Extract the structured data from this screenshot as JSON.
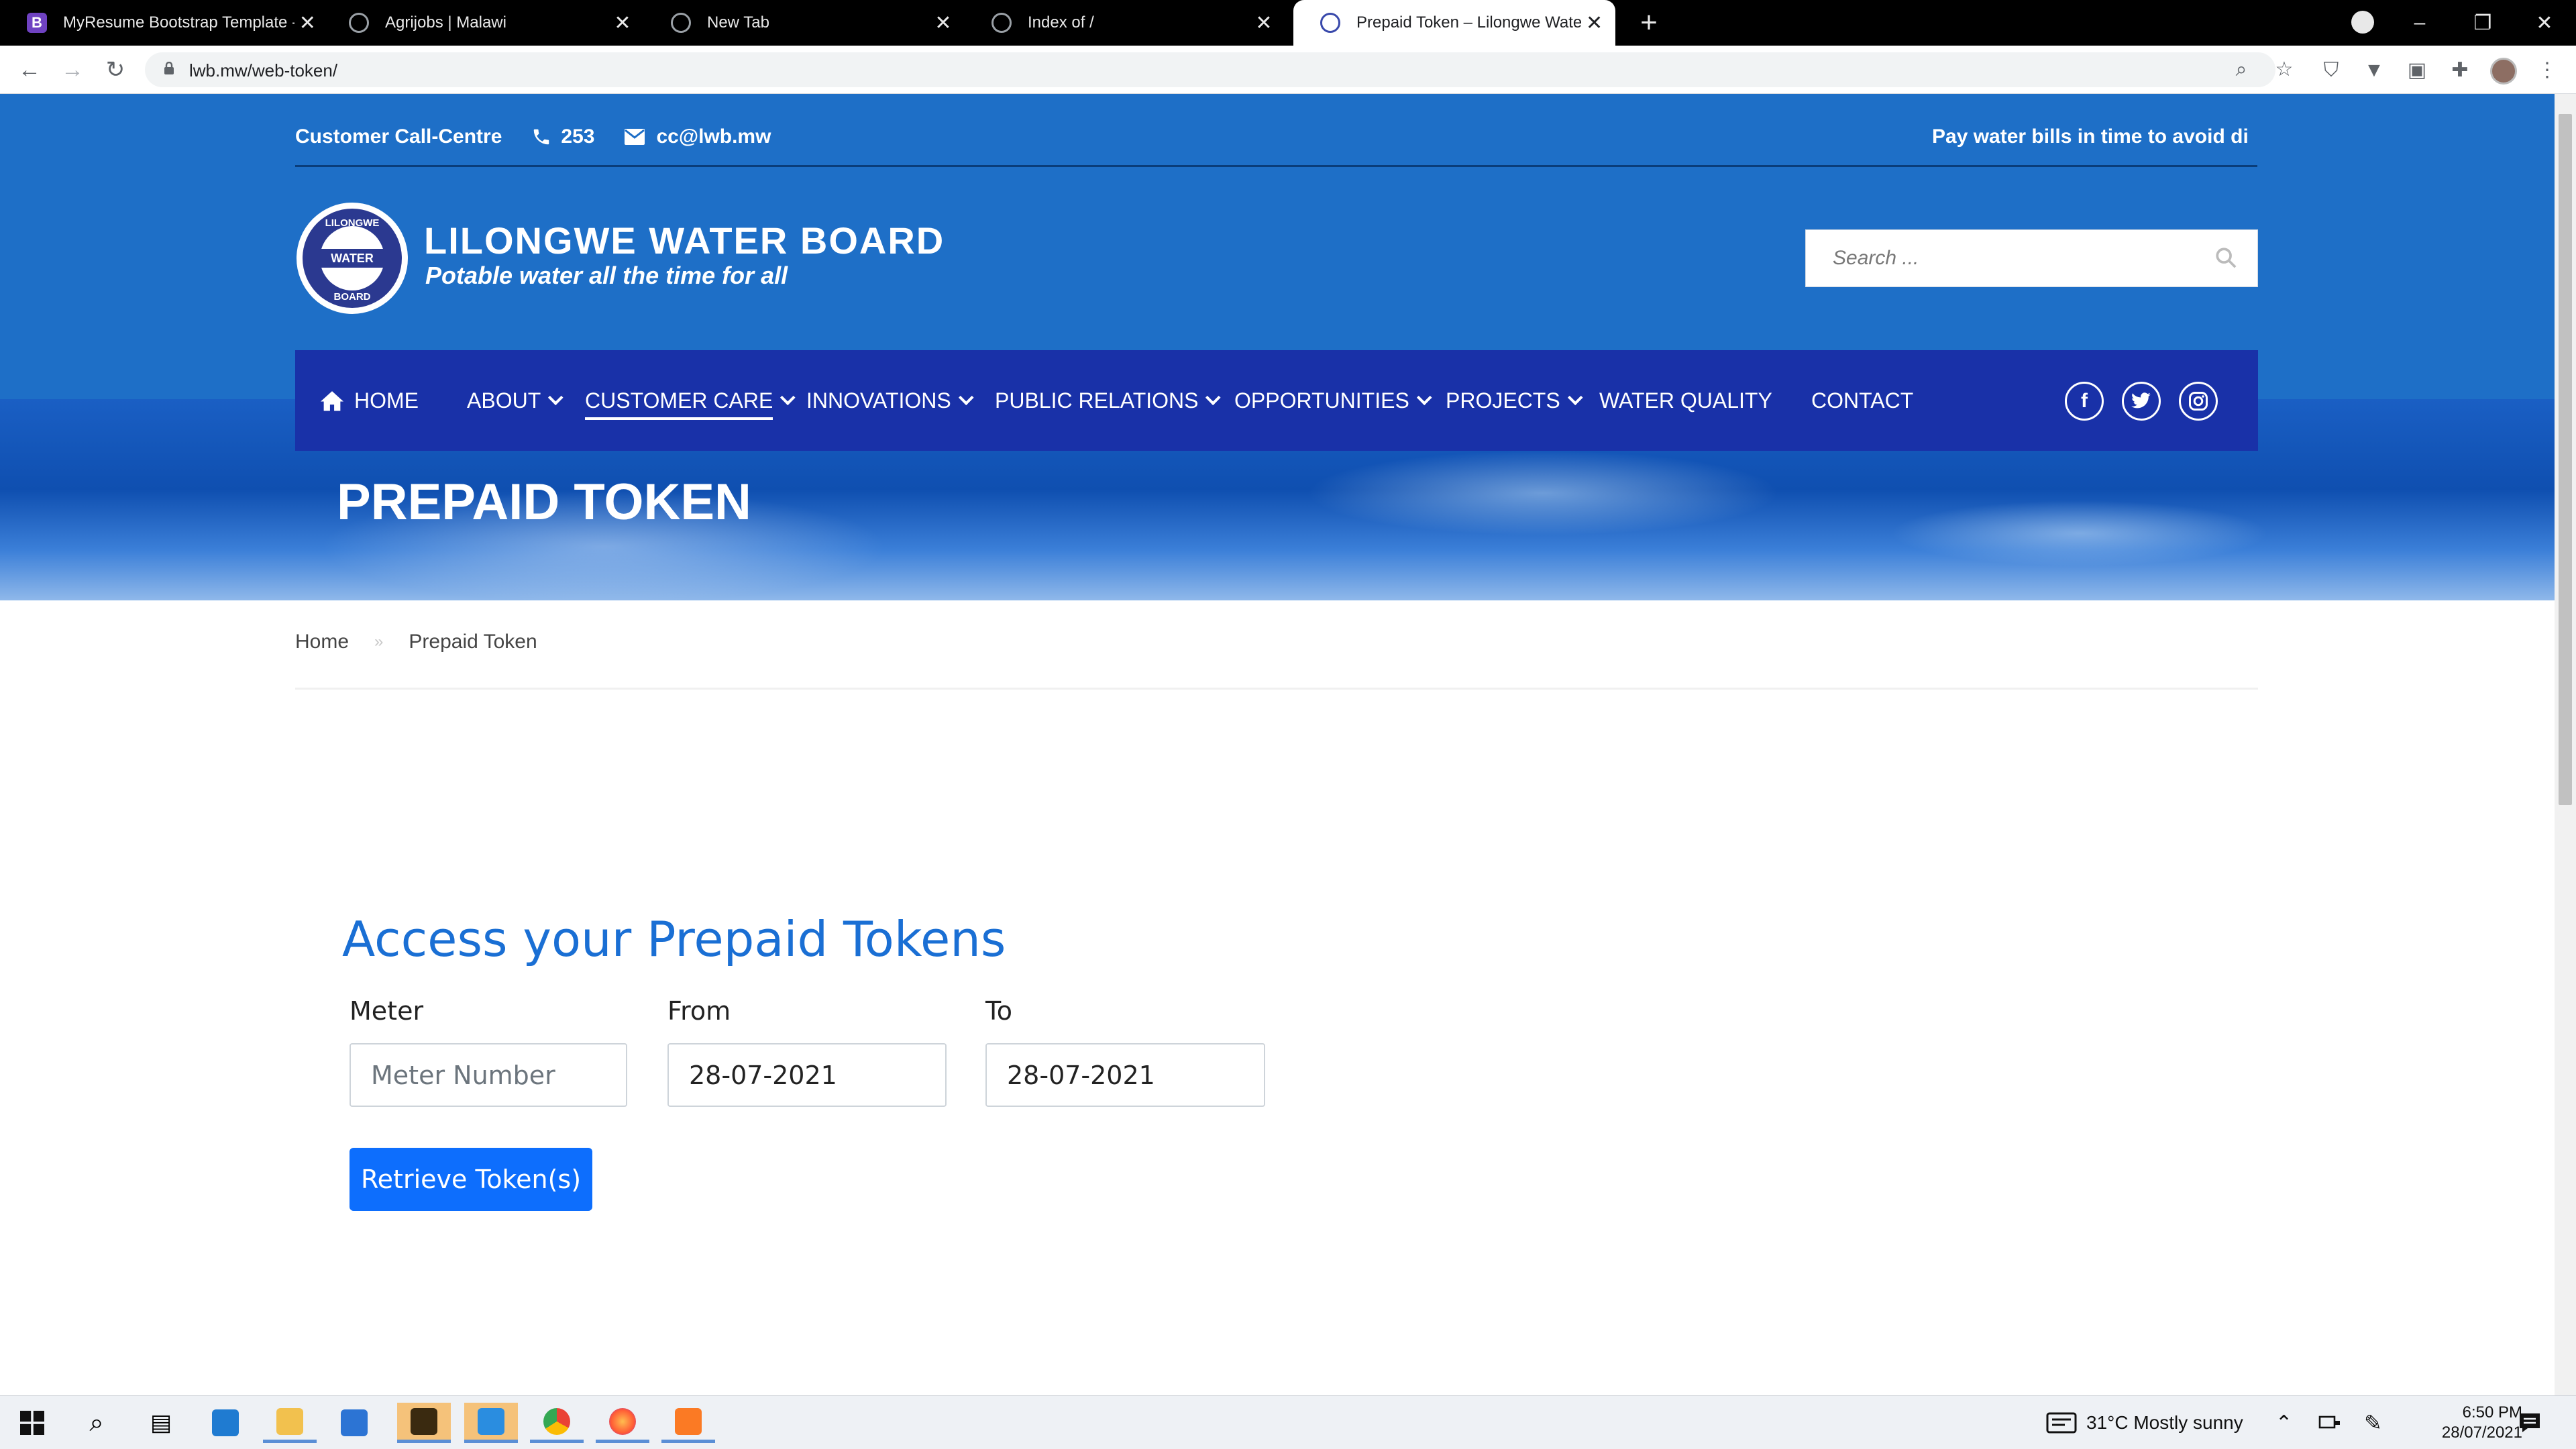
{
  "browser": {
    "tabs": [
      {
        "title": "MyResume Bootstrap Template -",
        "favicon": "B"
      },
      {
        "title": "Agrijobs | Malawi",
        "favicon": ""
      },
      {
        "title": "New Tab",
        "favicon": ""
      },
      {
        "title": "Index of /",
        "favicon": ""
      },
      {
        "title": "Prepaid Token – Lilongwe Water",
        "favicon": ""
      }
    ],
    "url": "lwb.mw/web-token/",
    "controls": {
      "minimize": "–",
      "restore": "❐",
      "close": "✕",
      "new_tab": "+"
    }
  },
  "site": {
    "topbar": {
      "callcentre_label": "Customer Call-Centre",
      "phone": "253",
      "email": "cc@lwb.mw",
      "ticker": "Pay water bills in time to avoid di"
    },
    "brand": {
      "name": "LILONGWE WATER BOARD",
      "tagline": "Potable water all the time for all",
      "logo_ring_top": "LILONGWE",
      "logo_center": "WATER",
      "logo_ring_bottom": "BOARD"
    },
    "search": {
      "placeholder": "Search ..."
    },
    "nav": {
      "home": "HOME",
      "about": "ABOUT",
      "customer_care": "CUSTOMER CARE",
      "innovations": "INNOVATIONS",
      "public_relations": "PUBLIC RELATIONS",
      "opportunities": "OPPORTUNITIES",
      "projects": "PROJECTS",
      "water_quality": "WATER QUALITY",
      "contact": "CONTACT"
    },
    "social": {
      "facebook": "f",
      "twitter": "t",
      "instagram": "◎"
    },
    "hero_title": "PREPAID TOKEN",
    "breadcrumb": {
      "home": "Home",
      "separator": "»",
      "current": "Prepaid Token"
    },
    "form": {
      "heading": "Access your Prepaid Tokens",
      "meter_label": "Meter",
      "meter_placeholder": "Meter Number",
      "from_label": "From",
      "from_value": "28-07-2021",
      "to_label": "To",
      "to_value": "28-07-2021",
      "submit": "Retrieve Token(s)"
    }
  },
  "taskbar": {
    "weather": "31°C  Mostly sunny",
    "time": "6:50 PM",
    "date": "28/07/2021"
  },
  "colors": {
    "header_blue": "#1e6fc7",
    "nav_blue": "#1931a8",
    "heading_blue": "#1a6fd4",
    "button_blue": "#0d6efd"
  }
}
